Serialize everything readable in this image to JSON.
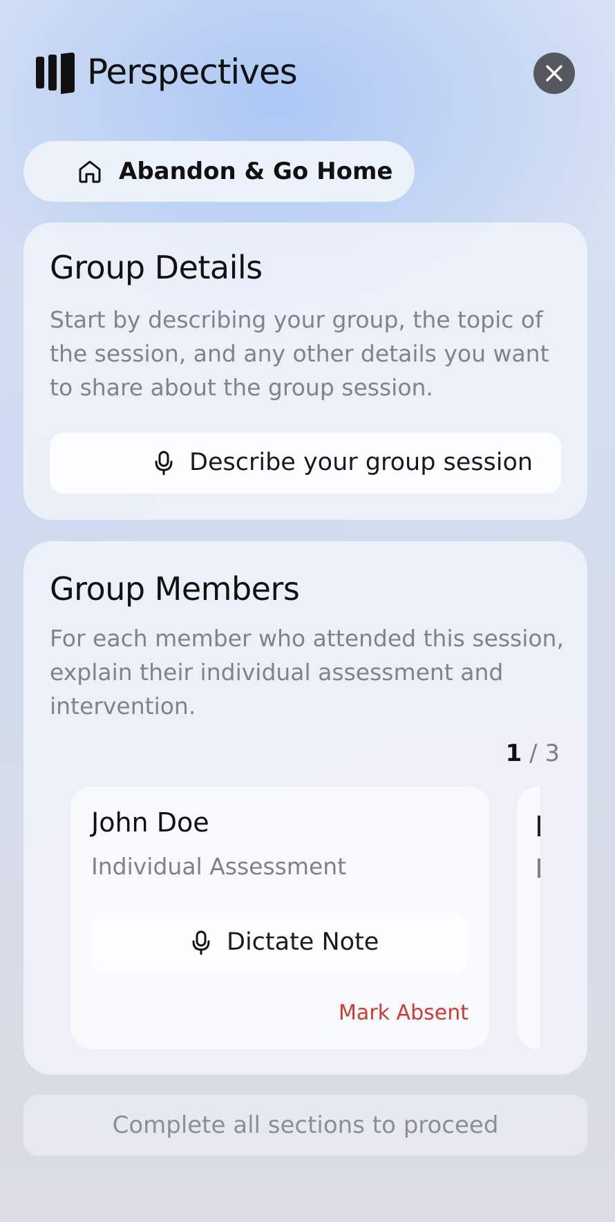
{
  "header": {
    "app_title": "Perspectives",
    "logo_icon": "perspectives-logo-icon",
    "close_icon": "close-icon"
  },
  "home_button": {
    "label": "Abandon & Go Home",
    "icon": "home-icon"
  },
  "group_details": {
    "title": "Group Details",
    "description": "Start by describing your group, the topic of the session, and any other details you want to share about the group session.",
    "button_label": "Describe your group session",
    "button_icon": "microphone-icon"
  },
  "group_members": {
    "title": "Group Members",
    "description": "For each member who attended this session, explain their individual assessment and intervention.",
    "counter_current": "1",
    "counter_sep": " / ",
    "counter_total": "3",
    "members": [
      {
        "name": "John Doe",
        "subtitle": "Individual Assessment",
        "dictate_label": "Dictate Note",
        "dictate_icon": "microphone-icon",
        "absent_label": "Mark Absent"
      }
    ]
  },
  "footer": {
    "proceed_label": "Complete all sections to proceed"
  },
  "colors": {
    "accent_red": "#d23a31",
    "close_button_bg": "#55585e",
    "muted_text": "#7f838c"
  }
}
